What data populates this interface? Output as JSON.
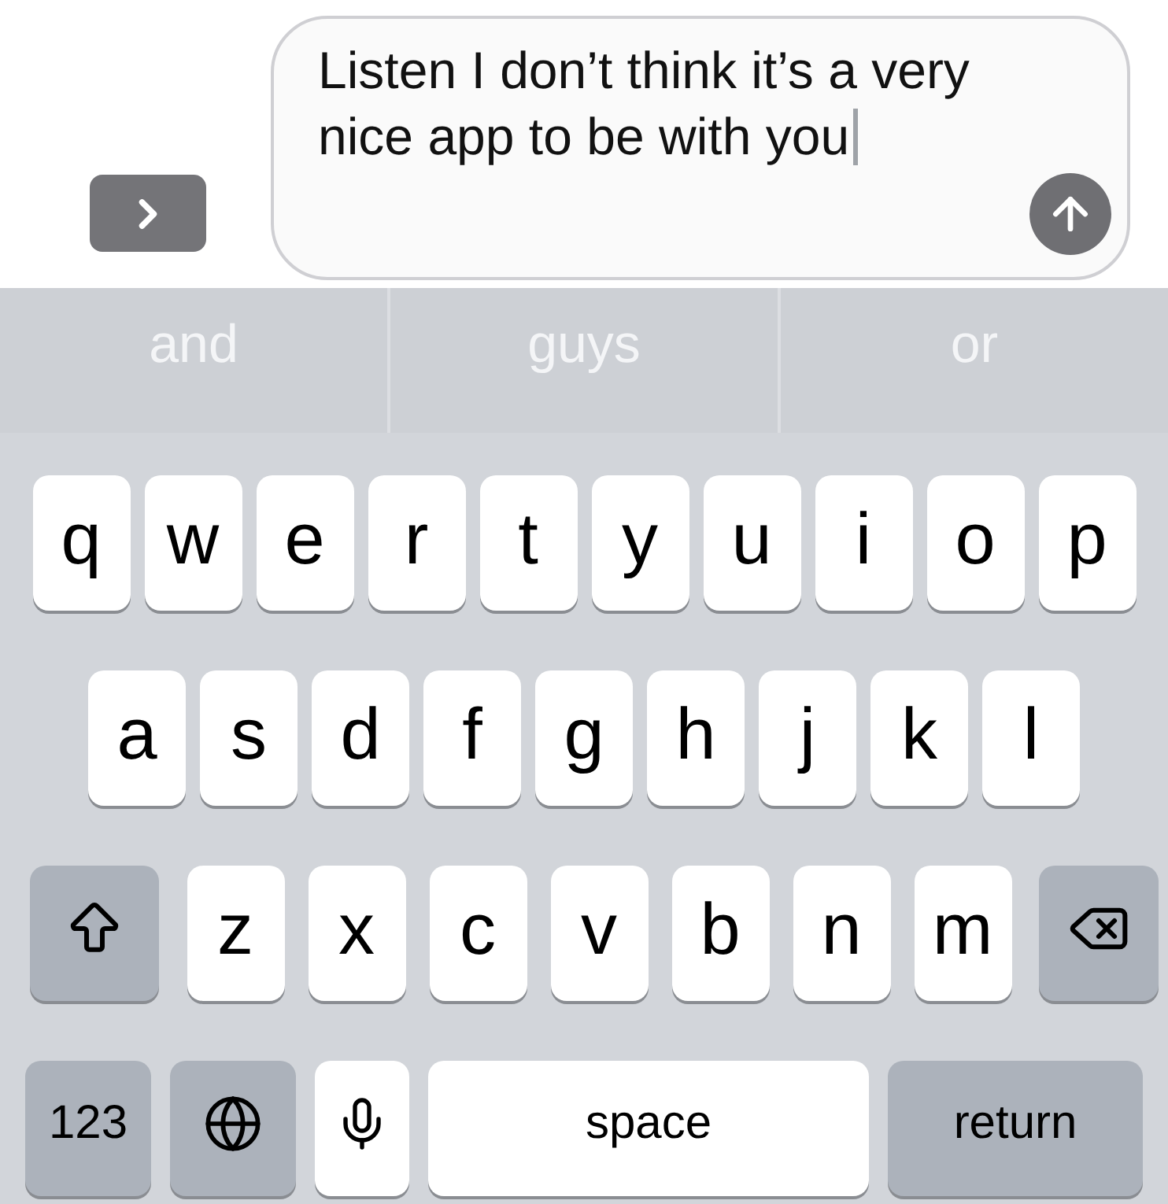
{
  "composer": {
    "message": "Listen I don’t think it’s a very nice app to be with you"
  },
  "suggestions": [
    "and",
    "guys",
    "or"
  ],
  "keyboard": {
    "rows": [
      {
        "keys": [
          {
            "kind": "letter",
            "label": "q"
          },
          {
            "kind": "letter",
            "label": "w"
          },
          {
            "kind": "letter",
            "label": "e"
          },
          {
            "kind": "letter",
            "label": "r"
          },
          {
            "kind": "letter",
            "label": "t"
          },
          {
            "kind": "letter",
            "label": "y"
          },
          {
            "kind": "letter",
            "label": "u"
          },
          {
            "kind": "letter",
            "label": "i"
          },
          {
            "kind": "letter",
            "label": "o"
          },
          {
            "kind": "letter",
            "label": "p"
          }
        ]
      },
      {
        "keys": [
          {
            "kind": "letter",
            "label": "a"
          },
          {
            "kind": "letter",
            "label": "s"
          },
          {
            "kind": "letter",
            "label": "d"
          },
          {
            "kind": "letter",
            "label": "f"
          },
          {
            "kind": "letter",
            "label": "g"
          },
          {
            "kind": "letter",
            "label": "h"
          },
          {
            "kind": "letter",
            "label": "j"
          },
          {
            "kind": "letter",
            "label": "k"
          },
          {
            "kind": "letter",
            "label": "l"
          }
        ]
      },
      {
        "keys": [
          {
            "kind": "shift"
          },
          {
            "kind": "letter",
            "label": "z"
          },
          {
            "kind": "letter",
            "label": "x"
          },
          {
            "kind": "letter",
            "label": "c"
          },
          {
            "kind": "letter",
            "label": "v"
          },
          {
            "kind": "letter",
            "label": "b"
          },
          {
            "kind": "letter",
            "label": "n"
          },
          {
            "kind": "letter",
            "label": "m"
          },
          {
            "kind": "backspace"
          }
        ]
      },
      {
        "keys": [
          {
            "kind": "mode",
            "label": "123"
          },
          {
            "kind": "globe"
          },
          {
            "kind": "mic"
          },
          {
            "kind": "space",
            "label": "space"
          },
          {
            "kind": "return",
            "label": "return"
          }
        ]
      }
    ]
  }
}
